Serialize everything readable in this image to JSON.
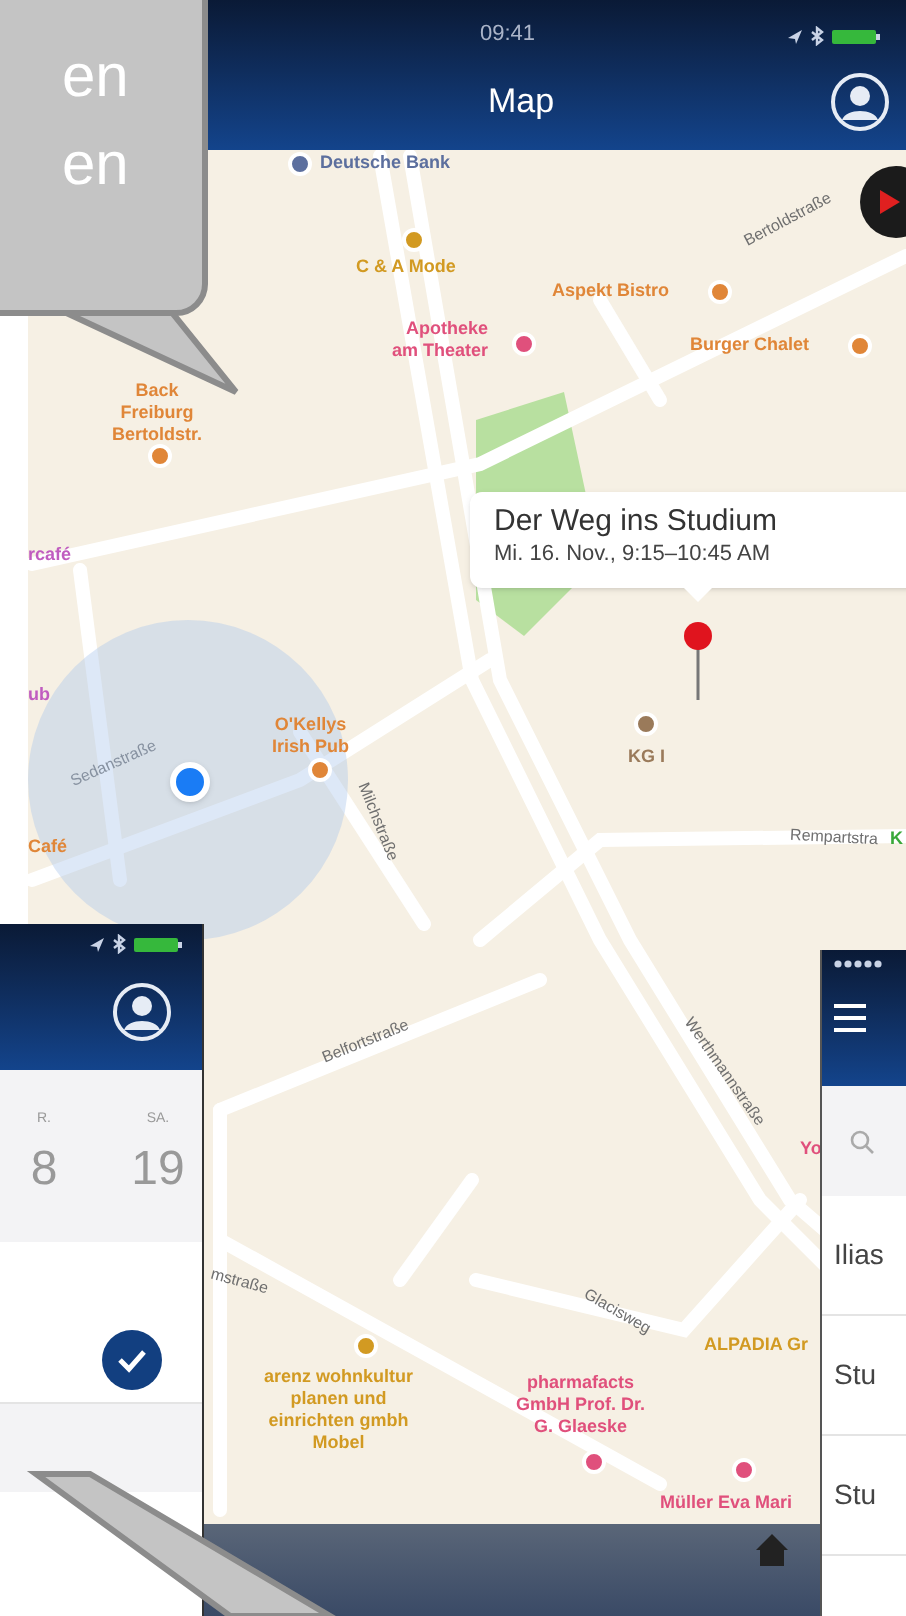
{
  "speech_bubble": {
    "lines": [
      "en",
      "en"
    ]
  },
  "map_screen": {
    "status_time": "09:41",
    "title": "Map",
    "places": [
      {
        "text": "Deutsche Bank",
        "color": "#5c6f9e"
      },
      {
        "text": "C & A Mode",
        "color": "#d29a22"
      },
      {
        "text": "Aspekt Bistro",
        "color": "#e08638"
      },
      {
        "text": "Apotheke\nam Theater",
        "color": "#e0507c"
      },
      {
        "text": "Burger Chalet",
        "color": "#e08638"
      },
      {
        "text": "Back\nFreiburg\nBertoldstr.",
        "color": "#e08638"
      },
      {
        "text": "rcafé",
        "color": "#c05cc0"
      },
      {
        "text": "ub",
        "color": "#c05cc0"
      },
      {
        "text": "O'Kellys\nIrish Pub",
        "color": "#e08638"
      },
      {
        "text": "Café",
        "color": "#e08638"
      },
      {
        "text": "KG I",
        "color": "#9a7a5a"
      },
      {
        "text": "K",
        "color": "#3aa83a"
      },
      {
        "text": "Yo",
        "color": "#e0507c"
      },
      {
        "text": "ALPADIA Gr",
        "color": "#d29a22"
      },
      {
        "text": "arenz wohnkultur\nplanen und\neinrichten gmbh\nMobel",
        "color": "#d29a22"
      },
      {
        "text": "pharmafacts\nGmbH Prof. Dr.\nG. Glaeske",
        "color": "#e0507c"
      },
      {
        "text": "Müller Eva Mari",
        "color": "#e0507c"
      }
    ],
    "streets": [
      "Bertoldstraße",
      "Sedanstraße",
      "Milchstraße",
      "Rempartstra",
      "Belfortstraße",
      "Werthmannstraße",
      "Glacisweg",
      "mstraße"
    ],
    "callout": {
      "title": "Der Weg ins Studium",
      "subtitle": "Mi. 16. Nov., 9:15–10:45 AM"
    }
  },
  "calendar_screen": {
    "days": [
      {
        "weekday": "R.",
        "date": "8"
      },
      {
        "weekday": "SA.",
        "date": "19"
      }
    ],
    "event": {
      "checked": true
    }
  },
  "menu_screen": {
    "items": [
      "Ilias",
      "Stu",
      "Stu"
    ]
  }
}
